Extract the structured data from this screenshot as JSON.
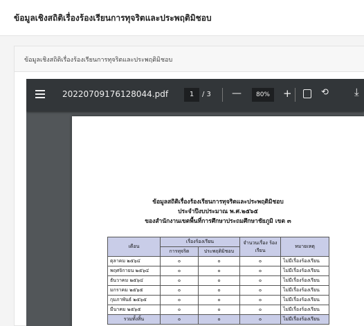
{
  "page": {
    "title": "ข้อมูลเชิงสถิติเรื่องร้องเรียนการทุจริตและประพฤติมิชอบ"
  },
  "card": {
    "title": "ข้อมูลเชิงสถิติเรื่องร้องเรียนการทุจริตและประพฤติมิชอบ"
  },
  "viewer": {
    "file_name": "20220709176128044.pdf",
    "current_page": "1",
    "page_separator": "/ 3",
    "zoom": "80%",
    "zoom_out": "—",
    "zoom_in": "+",
    "icons": [
      "menu-icon",
      "fit-page-icon",
      "rotate-icon",
      "download-icon"
    ]
  },
  "document": {
    "title_lines": [
      "ข้อมูลสถิติเรื่องร้องเรียนการทุจริตและประพฤติมิชอบ",
      "ประจำปีงบประมาณ พ.ศ.๒๕๖๕",
      "ของสำนักงานเขตพื้นที่การศึกษาประถมศึกษาชัยภูมิ เขต ๓"
    ],
    "table": {
      "headers": {
        "month": "เดือน",
        "complaints": "เรื่องร้องเรียน",
        "corruption": "การทุจริต",
        "misconduct": "ประพฤติมิชอบ",
        "count": "จำนวนเรื่อง ร้องเรียน",
        "remark": "หมายเหตุ"
      },
      "rows": [
        {
          "month": "ตุลาคม ๒๕๖๔",
          "corruption": "๐",
          "misconduct": "๐",
          "count": "๐",
          "remark": "ไม่มีเรื่องร้องเรียน"
        },
        {
          "month": "พฤศจิกายน ๒๕๖๔",
          "corruption": "๐",
          "misconduct": "๐",
          "count": "๐",
          "remark": "ไม่มีเรื่องร้องเรียน"
        },
        {
          "month": "ธันวาคม ๒๕๖๔",
          "corruption": "๐",
          "misconduct": "๐",
          "count": "๐",
          "remark": "ไม่มีเรื่องร้องเรียน"
        },
        {
          "month": "มกราคม ๒๕๖๕",
          "corruption": "๐",
          "misconduct": "๐",
          "count": "๐",
          "remark": "ไม่มีเรื่องร้องเรียน"
        },
        {
          "month": "กุมภาพันธ์ ๒๕๖๕",
          "corruption": "๐",
          "misconduct": "๐",
          "count": "๐",
          "remark": "ไม่มีเรื่องร้องเรียน"
        },
        {
          "month": "มีนาคม ๒๕๖๕",
          "corruption": "๐",
          "misconduct": "๐",
          "count": "๐",
          "remark": "ไม่มีเรื่องร้องเรียน"
        }
      ],
      "total": {
        "label": "รวมทั้งสิ้น",
        "corruption": "๐",
        "misconduct": "๐",
        "count": "๐",
        "remark": "ไม่มีเรื่องร้องเรียน"
      }
    }
  }
}
